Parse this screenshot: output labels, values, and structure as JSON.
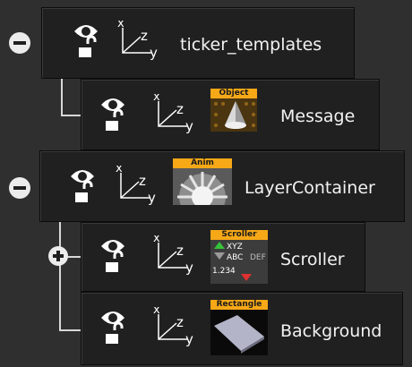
{
  "nodes": [
    {
      "label": "ticker_templates",
      "expander": "collapse-icon",
      "thumbnail": null
    },
    {
      "label": "Message",
      "expander": null,
      "thumbnail": {
        "tag": "Object",
        "icon": "object-cone-icon"
      }
    },
    {
      "label": "LayerContainer",
      "expander": "collapse-icon",
      "thumbnail": {
        "tag": "Anim",
        "icon": "anim-wheel-icon"
      }
    },
    {
      "label": "Scroller",
      "expander": "expand-icon",
      "thumbnail": {
        "tag": "Scroller",
        "icon": "scroller-icon",
        "lines": [
          "XYZ",
          "ABC",
          "1.234",
          "DEF"
        ]
      }
    },
    {
      "label": "Background",
      "expander": null,
      "thumbnail": {
        "tag": "Rectangle",
        "icon": "rectangle-icon"
      }
    }
  ],
  "axis_labels": {
    "x": "x",
    "y": "y",
    "z": "z"
  },
  "colors": {
    "tag_bg": "#f6a817",
    "panel": "#202020",
    "text": "#f2f2f2"
  }
}
